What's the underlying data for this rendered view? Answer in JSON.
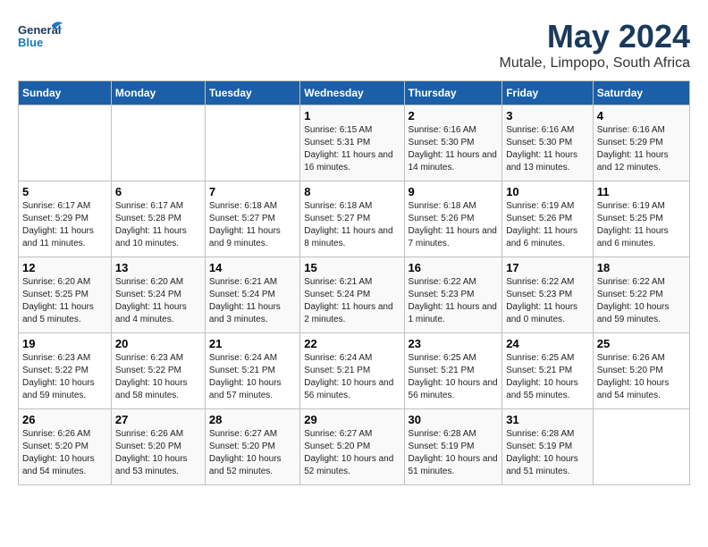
{
  "logo": {
    "general": "General",
    "blue": "Blue",
    "tagline": "General Blue"
  },
  "header": {
    "title": "May 2024",
    "subtitle": "Mutale, Limpopo, South Africa"
  },
  "weekdays": [
    "Sunday",
    "Monday",
    "Tuesday",
    "Wednesday",
    "Thursday",
    "Friday",
    "Saturday"
  ],
  "weeks": [
    [
      {
        "day": "",
        "info": ""
      },
      {
        "day": "",
        "info": ""
      },
      {
        "day": "",
        "info": ""
      },
      {
        "day": "1",
        "info": "Sunrise: 6:15 AM\nSunset: 5:31 PM\nDaylight: 11 hours and 16 minutes."
      },
      {
        "day": "2",
        "info": "Sunrise: 6:16 AM\nSunset: 5:30 PM\nDaylight: 11 hours and 14 minutes."
      },
      {
        "day": "3",
        "info": "Sunrise: 6:16 AM\nSunset: 5:30 PM\nDaylight: 11 hours and 13 minutes."
      },
      {
        "day": "4",
        "info": "Sunrise: 6:16 AM\nSunset: 5:29 PM\nDaylight: 11 hours and 12 minutes."
      }
    ],
    [
      {
        "day": "5",
        "info": "Sunrise: 6:17 AM\nSunset: 5:29 PM\nDaylight: 11 hours and 11 minutes."
      },
      {
        "day": "6",
        "info": "Sunrise: 6:17 AM\nSunset: 5:28 PM\nDaylight: 11 hours and 10 minutes."
      },
      {
        "day": "7",
        "info": "Sunrise: 6:18 AM\nSunset: 5:27 PM\nDaylight: 11 hours and 9 minutes."
      },
      {
        "day": "8",
        "info": "Sunrise: 6:18 AM\nSunset: 5:27 PM\nDaylight: 11 hours and 8 minutes."
      },
      {
        "day": "9",
        "info": "Sunrise: 6:18 AM\nSunset: 5:26 PM\nDaylight: 11 hours and 7 minutes."
      },
      {
        "day": "10",
        "info": "Sunrise: 6:19 AM\nSunset: 5:26 PM\nDaylight: 11 hours and 6 minutes."
      },
      {
        "day": "11",
        "info": "Sunrise: 6:19 AM\nSunset: 5:25 PM\nDaylight: 11 hours and 6 minutes."
      }
    ],
    [
      {
        "day": "12",
        "info": "Sunrise: 6:20 AM\nSunset: 5:25 PM\nDaylight: 11 hours and 5 minutes."
      },
      {
        "day": "13",
        "info": "Sunrise: 6:20 AM\nSunset: 5:24 PM\nDaylight: 11 hours and 4 minutes."
      },
      {
        "day": "14",
        "info": "Sunrise: 6:21 AM\nSunset: 5:24 PM\nDaylight: 11 hours and 3 minutes."
      },
      {
        "day": "15",
        "info": "Sunrise: 6:21 AM\nSunset: 5:24 PM\nDaylight: 11 hours and 2 minutes."
      },
      {
        "day": "16",
        "info": "Sunrise: 6:22 AM\nSunset: 5:23 PM\nDaylight: 11 hours and 1 minute."
      },
      {
        "day": "17",
        "info": "Sunrise: 6:22 AM\nSunset: 5:23 PM\nDaylight: 11 hours and 0 minutes."
      },
      {
        "day": "18",
        "info": "Sunrise: 6:22 AM\nSunset: 5:22 PM\nDaylight: 10 hours and 59 minutes."
      }
    ],
    [
      {
        "day": "19",
        "info": "Sunrise: 6:23 AM\nSunset: 5:22 PM\nDaylight: 10 hours and 59 minutes."
      },
      {
        "day": "20",
        "info": "Sunrise: 6:23 AM\nSunset: 5:22 PM\nDaylight: 10 hours and 58 minutes."
      },
      {
        "day": "21",
        "info": "Sunrise: 6:24 AM\nSunset: 5:21 PM\nDaylight: 10 hours and 57 minutes."
      },
      {
        "day": "22",
        "info": "Sunrise: 6:24 AM\nSunset: 5:21 PM\nDaylight: 10 hours and 56 minutes."
      },
      {
        "day": "23",
        "info": "Sunrise: 6:25 AM\nSunset: 5:21 PM\nDaylight: 10 hours and 56 minutes."
      },
      {
        "day": "24",
        "info": "Sunrise: 6:25 AM\nSunset: 5:21 PM\nDaylight: 10 hours and 55 minutes."
      },
      {
        "day": "25",
        "info": "Sunrise: 6:26 AM\nSunset: 5:20 PM\nDaylight: 10 hours and 54 minutes."
      }
    ],
    [
      {
        "day": "26",
        "info": "Sunrise: 6:26 AM\nSunset: 5:20 PM\nDaylight: 10 hours and 54 minutes."
      },
      {
        "day": "27",
        "info": "Sunrise: 6:26 AM\nSunset: 5:20 PM\nDaylight: 10 hours and 53 minutes."
      },
      {
        "day": "28",
        "info": "Sunrise: 6:27 AM\nSunset: 5:20 PM\nDaylight: 10 hours and 52 minutes."
      },
      {
        "day": "29",
        "info": "Sunrise: 6:27 AM\nSunset: 5:20 PM\nDaylight: 10 hours and 52 minutes."
      },
      {
        "day": "30",
        "info": "Sunrise: 6:28 AM\nSunset: 5:19 PM\nDaylight: 10 hours and 51 minutes."
      },
      {
        "day": "31",
        "info": "Sunrise: 6:28 AM\nSunset: 5:19 PM\nDaylight: 10 hours and 51 minutes."
      },
      {
        "day": "",
        "info": ""
      }
    ]
  ]
}
